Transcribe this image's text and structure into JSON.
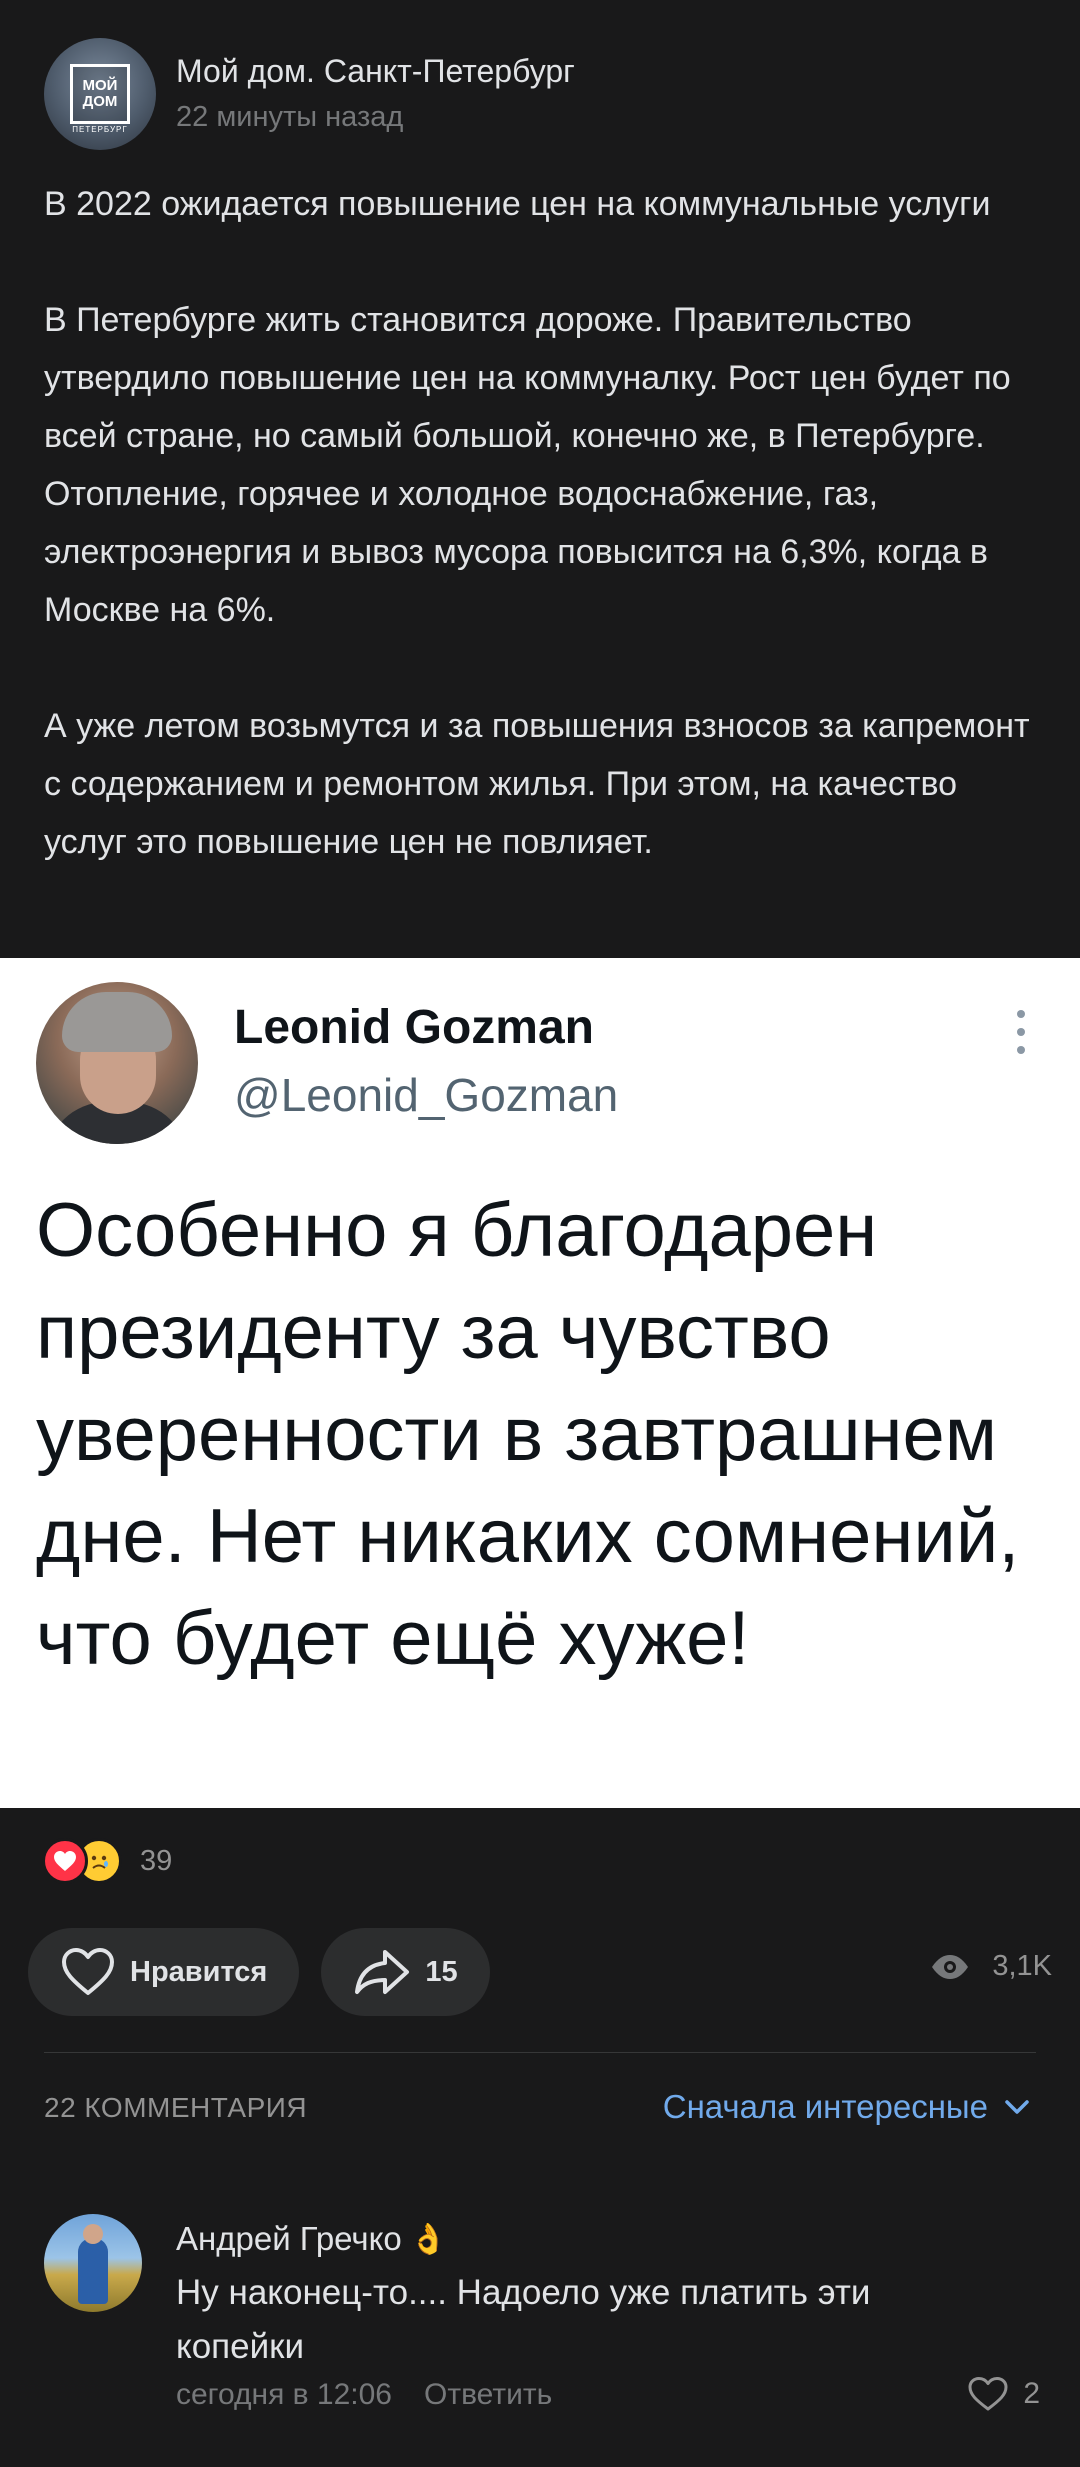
{
  "post": {
    "group_name": "Мой дом. Санкт-Петербург",
    "time": "22 минуты назад",
    "avatar_logo_line1": "МОЙ",
    "avatar_logo_line2": "ДОМ",
    "avatar_logo_sub": "ПЕТЕРБУРГ",
    "paragraphs": [
      "В 2022 ожидается повышение цен на коммунальные услуги",
      "В Петербурге жить становится дороже. Правительство утвердило повышение цен на коммуналку. Рост цен будет по всей стране, но самый большой, конечно же, в Петербурге. Отопление, горячее и холодное водоснабжение, газ, электроэнергия и вывоз мусора повысится на 6,3%, когда в Москве на 6%.",
      "А уже летом возьмутся и за повышения взносов за капремонт с содержанием и ремонтом жилья. При этом, на качество услуг это повышение цен не повлияет."
    ]
  },
  "tweet": {
    "name": "Leonid Gozman",
    "handle": "@Leonid_Gozman",
    "text": "Особенно я благодарен президенту за чувство уверенности в завтрашнем дне. Нет никаких сомнений, что будет ещё хуже!"
  },
  "reactions": {
    "count": "39"
  },
  "actions": {
    "like_label": "Нравится",
    "share_count": "15",
    "views": "3,1K"
  },
  "comments": {
    "count_label": "22 КОММЕНТАРИЯ",
    "sort_label": "Сначала интересные",
    "items": [
      {
        "author": "Андрей Гречко",
        "author_emoji": "👌",
        "text": "Ну наконец-то.... Надоело уже платить эти копейки",
        "time": "сегодня в 12:06",
        "reply_label": "Ответить",
        "likes": "2"
      }
    ]
  },
  "colors": {
    "background": "#19191a",
    "accent": "#71aaeb",
    "text": "#e1e3e6",
    "secondary": "#76787a"
  }
}
